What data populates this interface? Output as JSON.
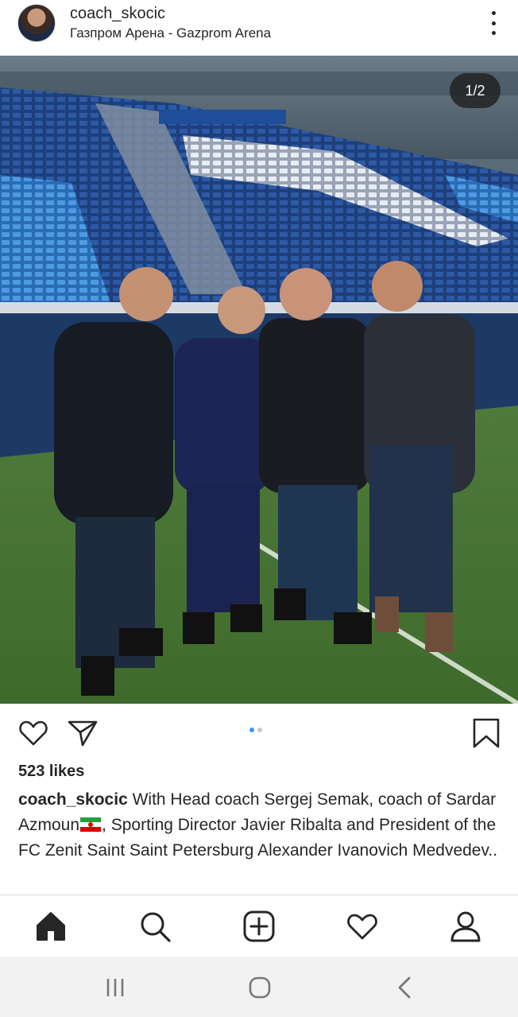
{
  "post": {
    "username": "coach_skocic",
    "location": "Газпром Арена - Gazprom Arena",
    "image_counter": "1/2",
    "carousel": {
      "total": 2,
      "current": 1
    },
    "likes": "523 likes",
    "caption": {
      "user": "coach_skocic",
      "text_before_flag": " With Head coach Sergej  Semak, coach of Sardar Azmoun",
      "text_after_flag": ", Sporting Director Javier Ribalta and President of the FC Zenit Saint Saint Petersburg Alexander Ivanovich Medvedev..",
      "flag_icon": "iran-flag"
    }
  },
  "icons": {
    "more": "more-vertical-icon",
    "like": "heart-icon",
    "share": "paper-plane-icon",
    "save": "bookmark-icon"
  },
  "tabbar": {
    "items": [
      "home-icon",
      "search-icon",
      "add-post-icon",
      "activity-heart-icon",
      "profile-icon"
    ],
    "active": "home-icon"
  },
  "system_nav": [
    "recents-icon",
    "home-circle-icon",
    "back-icon"
  ],
  "colors": {
    "text": "#262626",
    "accent_blue": "#3897f0",
    "counter_bg": "#1e1e1e",
    "nav_bg": "#f2f2f2"
  }
}
